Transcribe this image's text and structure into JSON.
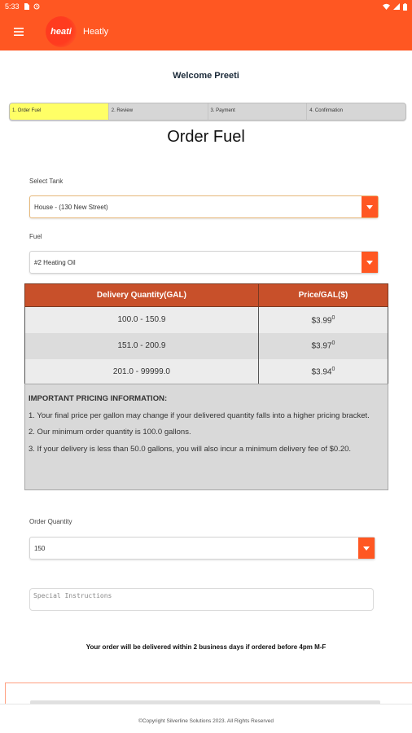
{
  "status_bar": {
    "time": "5:33"
  },
  "app_bar": {
    "logo_text": "heati",
    "title": "Heatly"
  },
  "welcome": "Welcome Preeti",
  "steps": [
    "1. Order Fuel",
    "2. Review",
    "3. Payment",
    "4. Confirmation"
  ],
  "active_step": 0,
  "page_title": "Order Fuel",
  "tank": {
    "label": "Select Tank",
    "value": "House - (130 New Street)"
  },
  "fuel": {
    "label": "Fuel",
    "value": "#2 Heating Oil"
  },
  "price_table": {
    "headers": [
      "Delivery Quantity(GAL)",
      "Price/GAL($)"
    ],
    "rows": [
      {
        "qty": "100.0 - 150.9",
        "price": "$3.99",
        "sup": "0"
      },
      {
        "qty": "151.0 - 200.9",
        "price": "$3.97",
        "sup": "0"
      },
      {
        "qty": "201.0 - 99999.0",
        "price": "$3.94",
        "sup": "0"
      }
    ]
  },
  "pricing_info": {
    "heading": "IMPORTANT PRICING INFORMATION:",
    "lines": [
      "1. Your final price per gallon may change if your delivered quantity falls into a higher pricing bracket.",
      "2. Our minimum order quantity is 100.0 gallons.",
      "3. If your delivery is less than 50.0 gallons, you will also incur a minimum delivery fee of $0.20."
    ]
  },
  "order_quantity": {
    "label": "Order Quantity",
    "value": "150"
  },
  "special_instructions": {
    "placeholder": "Special Instructions"
  },
  "delivery_note": "Your order will be delivered within 2 business days if ordered before 4pm M-F",
  "footer": "©Copyright Silverline Solutions 2023. All Rights Reserved",
  "colors": {
    "primary": "#ff5722",
    "table_header": "#c8502a",
    "active_step": "#ffff66"
  }
}
